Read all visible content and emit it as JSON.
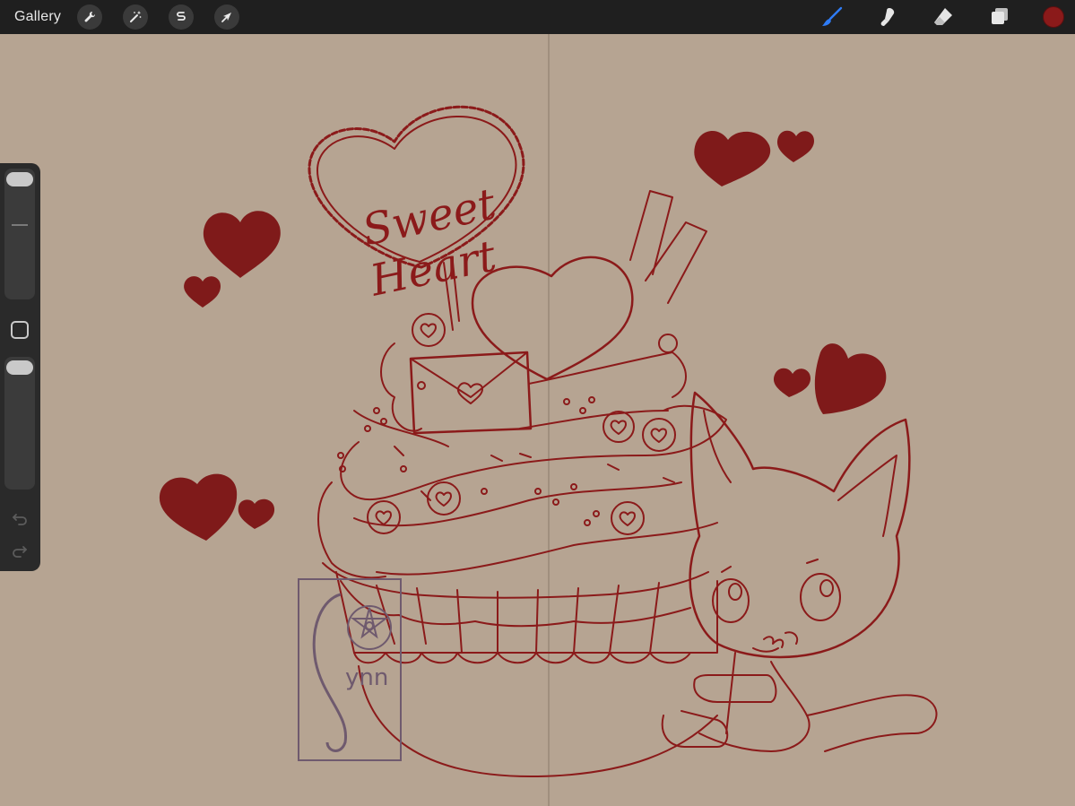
{
  "topbar": {
    "gallery_label": "Gallery",
    "actions_icon": "wrench-icon",
    "adjustments_icon": "magic-wand-icon",
    "selection_icon": "selection-s-icon",
    "transform_icon": "arrow-cursor-icon",
    "brush_icon": "brush-icon",
    "smudge_icon": "smudge-icon",
    "eraser_icon": "eraser-icon",
    "layers_icon": "layers-icon",
    "current_color": "#8b1a1a"
  },
  "sidebar": {
    "brush_size": 0.95,
    "opacity": 1.0,
    "undo_icon": "undo-icon",
    "redo_icon": "redo-icon"
  },
  "canvas": {
    "background": "#b6a492",
    "line_color": "#8b1a1a",
    "sign_text_line1": "Sweet",
    "sign_text_line2": "Heart",
    "signature_text": "ynn"
  }
}
